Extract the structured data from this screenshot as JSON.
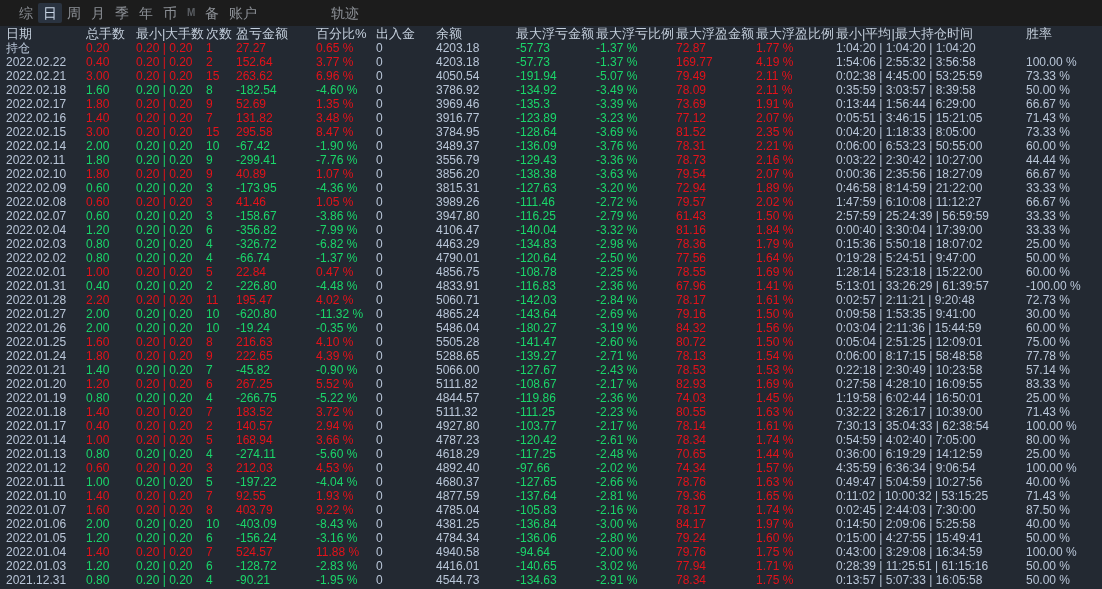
{
  "tabs": [
    {
      "label": "综",
      "selected": false,
      "disabled": false
    },
    {
      "label": "日",
      "selected": true,
      "disabled": false
    },
    {
      "label": "周",
      "selected": false,
      "disabled": false
    },
    {
      "label": "月",
      "selected": false,
      "disabled": false
    },
    {
      "label": "季",
      "selected": false,
      "disabled": false
    },
    {
      "label": "年",
      "selected": false,
      "disabled": false
    },
    {
      "label": "币",
      "selected": false,
      "disabled": false
    },
    {
      "label": "M",
      "selected": false,
      "disabled": true
    },
    {
      "label": "备",
      "selected": false,
      "disabled": false
    },
    {
      "label": "账户",
      "selected": false,
      "disabled": false
    },
    {
      "label": "轨迹",
      "selected": false,
      "disabled": false
    }
  ],
  "table": {
    "columns": [
      "日期",
      "总手数",
      "最小|大手数",
      "次数",
      "盈亏金额",
      "百分比%",
      "出入金",
      "余额",
      "最大浮亏金额",
      "最大浮亏比例",
      "最大浮盈金额",
      "最大浮盈比例",
      "最小|平均|最大持仓时间",
      "胜率"
    ],
    "rows": [
      {
        "kind": "profit",
        "cells": [
          "持仓",
          "0.20",
          "0.20 | 0.20",
          "1",
          "27.27",
          "0.65 %",
          "0",
          "4203.18",
          "-57.73",
          "-1.37 %",
          "72.87",
          "1.77 %",
          "1:04:20 | 1:04:20 | 1:04:20"
        ]
      },
      {
        "kind": "profit",
        "cells": [
          "2022.02.22",
          "0.40",
          "0.20 | 0.20",
          "2",
          "152.64",
          "3.77 %",
          "0",
          "4203.18",
          "-57.73",
          "-1.37 %",
          "169.77",
          "4.19 %",
          "1:54:06 | 2:55:32 | 3:56:58",
          "100.00 %"
        ]
      },
      {
        "kind": "profit",
        "cells": [
          "2022.02.21",
          "3.00",
          "0.20 | 0.20",
          "15",
          "263.62",
          "6.96 %",
          "0",
          "4050.54",
          "-191.94",
          "-5.07 %",
          "79.49",
          "2.11 %",
          "0:02:38 | 4:45:00 | 53:25:59",
          "73.33 %"
        ]
      },
      {
        "kind": "loss",
        "cells": [
          "2022.02.18",
          "1.60",
          "0.20 | 0.20",
          "8",
          "-182.54",
          "-4.60 %",
          "0",
          "3786.92",
          "-134.92",
          "-3.49 %",
          "78.09",
          "2.11 %",
          "0:35:59 | 3:03:57 | 8:39:58",
          "50.00 %"
        ]
      },
      {
        "kind": "profit",
        "cells": [
          "2022.02.17",
          "1.80",
          "0.20 | 0.20",
          "9",
          "52.69",
          "1.35 %",
          "0",
          "3969.46",
          "-135.3",
          "-3.39 %",
          "73.69",
          "1.91 %",
          "0:13:44 | 1:56:44 | 6:29:00",
          "66.67 %"
        ]
      },
      {
        "kind": "profit",
        "cells": [
          "2022.02.16",
          "1.40",
          "0.20 | 0.20",
          "7",
          "131.82",
          "3.48 %",
          "0",
          "3916.77",
          "-123.89",
          "-3.23 %",
          "77.12",
          "2.07 %",
          "0:05:51 | 3:46:15 | 15:21:05",
          "71.43 %"
        ]
      },
      {
        "kind": "profit",
        "cells": [
          "2022.02.15",
          "3.00",
          "0.20 | 0.20",
          "15",
          "295.58",
          "8.47 %",
          "0",
          "3784.95",
          "-128.64",
          "-3.69 %",
          "81.52",
          "2.35 %",
          "0:04:20 | 1:18:33 | 8:05:00",
          "73.33 %"
        ]
      },
      {
        "kind": "loss",
        "cells": [
          "2022.02.14",
          "2.00",
          "0.20 | 0.20",
          "10",
          "-67.42",
          "-1.90 %",
          "0",
          "3489.37",
          "-136.09",
          "-3.76 %",
          "78.31",
          "2.21 %",
          "0:06:00 | 6:53:23 | 50:55:00",
          "60.00 %"
        ]
      },
      {
        "kind": "loss",
        "cells": [
          "2022.02.11",
          "1.80",
          "0.20 | 0.20",
          "9",
          "-299.41",
          "-7.76 %",
          "0",
          "3556.79",
          "-129.43",
          "-3.36 %",
          "78.73",
          "2.16 %",
          "0:03:22 | 2:30:42 | 10:27:00",
          "44.44 %"
        ]
      },
      {
        "kind": "profit",
        "cells": [
          "2022.02.10",
          "1.80",
          "0.20 | 0.20",
          "9",
          "40.89",
          "1.07 %",
          "0",
          "3856.20",
          "-138.38",
          "-3.63 %",
          "79.54",
          "2.07 %",
          "0:00:36 | 2:35:56 | 18:27:09",
          "66.67 %"
        ]
      },
      {
        "kind": "loss",
        "cells": [
          "2022.02.09",
          "0.60",
          "0.20 | 0.20",
          "3",
          "-173.95",
          "-4.36 %",
          "0",
          "3815.31",
          "-127.63",
          "-3.20 %",
          "72.94",
          "1.89 %",
          "0:46:58 | 8:14:59 | 21:22:00",
          "33.33 %"
        ]
      },
      {
        "kind": "profit",
        "cells": [
          "2022.02.08",
          "0.60",
          "0.20 | 0.20",
          "3",
          "41.46",
          "1.05 %",
          "0",
          "3989.26",
          "-111.46",
          "-2.72 %",
          "79.57",
          "2.02 %",
          "1:47:59 | 6:10:08 | 11:12:27",
          "66.67 %"
        ]
      },
      {
        "kind": "loss",
        "cells": [
          "2022.02.07",
          "0.60",
          "0.20 | 0.20",
          "3",
          "-158.67",
          "-3.86 %",
          "0",
          "3947.80",
          "-116.25",
          "-2.79 %",
          "61.43",
          "1.50 %",
          "2:57:59 | 25:24:39 | 56:59:59",
          "33.33 %"
        ]
      },
      {
        "kind": "loss",
        "cells": [
          "2022.02.04",
          "1.20",
          "0.20 | 0.20",
          "6",
          "-356.82",
          "-7.99 %",
          "0",
          "4106.47",
          "-140.04",
          "-3.32 %",
          "81.16",
          "1.84 %",
          "0:00:40 | 3:30:04 | 17:39:00",
          "33.33 %"
        ]
      },
      {
        "kind": "loss",
        "cells": [
          "2022.02.03",
          "0.80",
          "0.20 | 0.20",
          "4",
          "-326.72",
          "-6.82 %",
          "0",
          "4463.29",
          "-134.83",
          "-2.98 %",
          "78.36",
          "1.79 %",
          "0:15:36 | 5:50:18 | 18:07:02",
          "25.00 %"
        ]
      },
      {
        "kind": "loss",
        "cells": [
          "2022.02.02",
          "0.80",
          "0.20 | 0.20",
          "4",
          "-66.74",
          "-1.37 %",
          "0",
          "4790.01",
          "-120.64",
          "-2.50 %",
          "77.56",
          "1.64 %",
          "0:19:28 | 5:24:51 | 9:47:00",
          "50.00 %"
        ]
      },
      {
        "kind": "profit",
        "cells": [
          "2022.02.01",
          "1.00",
          "0.20 | 0.20",
          "5",
          "22.84",
          "0.47 %",
          "0",
          "4856.75",
          "-108.78",
          "-2.25 %",
          "78.55",
          "1.69 %",
          "1:28:14 | 5:23:18 | 15:22:00",
          "60.00 %"
        ]
      },
      {
        "kind": "loss",
        "cells": [
          "2022.01.31",
          "0.40",
          "0.20 | 0.20",
          "2",
          "-226.80",
          "-4.48 %",
          "0",
          "4833.91",
          "-116.83",
          "-2.36 %",
          "67.96",
          "1.41 %",
          "5:13:01 | 33:26:29 | 61:39:57",
          "-100.00 %"
        ]
      },
      {
        "kind": "profit",
        "cells": [
          "2022.01.28",
          "2.20",
          "0.20 | 0.20",
          "11",
          "195.47",
          "4.02 %",
          "0",
          "5060.71",
          "-142.03",
          "-2.84 %",
          "78.17",
          "1.61 %",
          "0:02:57 | 2:11:21 | 9:20:48",
          "72.73 %"
        ]
      },
      {
        "kind": "loss",
        "cells": [
          "2022.01.27",
          "2.00",
          "0.20 | 0.20",
          "10",
          "-620.80",
          "-11.32 %",
          "0",
          "4865.24",
          "-143.64",
          "-2.69 %",
          "79.16",
          "1.50 %",
          "0:09:58 | 1:53:35 | 9:41:00",
          "30.00 %"
        ]
      },
      {
        "kind": "loss",
        "cells": [
          "2022.01.26",
          "2.00",
          "0.20 | 0.20",
          "10",
          "-19.24",
          "-0.35 %",
          "0",
          "5486.04",
          "-180.27",
          "-3.19 %",
          "84.32",
          "1.56 %",
          "0:03:04 | 2:11:36 | 15:44:59",
          "60.00 %"
        ]
      },
      {
        "kind": "profit",
        "cells": [
          "2022.01.25",
          "1.60",
          "0.20 | 0.20",
          "8",
          "216.63",
          "4.10 %",
          "0",
          "5505.28",
          "-141.47",
          "-2.60 %",
          "80.72",
          "1.50 %",
          "0:05:04 | 2:51:25 | 12:09:01",
          "75.00 %"
        ]
      },
      {
        "kind": "profit",
        "cells": [
          "2022.01.24",
          "1.80",
          "0.20 | 0.20",
          "9",
          "222.65",
          "4.39 %",
          "0",
          "5288.65",
          "-139.27",
          "-2.71 %",
          "78.13",
          "1.54 %",
          "0:06:00 | 8:17:15 | 58:48:58",
          "77.78 %"
        ]
      },
      {
        "kind": "loss",
        "cells": [
          "2022.01.21",
          "1.40",
          "0.20 | 0.20",
          "7",
          "-45.82",
          "-0.90 %",
          "0",
          "5066.00",
          "-127.67",
          "-2.43 %",
          "78.53",
          "1.53 %",
          "0:22:18 | 2:30:49 | 10:23:58",
          "57.14 %"
        ]
      },
      {
        "kind": "profit",
        "cells": [
          "2022.01.20",
          "1.20",
          "0.20 | 0.20",
          "6",
          "267.25",
          "5.52 %",
          "0",
          "5111.82",
          "-108.67",
          "-2.17 %",
          "82.93",
          "1.69 %",
          "0:27:58 | 4:28:10 | 16:09:55",
          "83.33 %"
        ]
      },
      {
        "kind": "loss",
        "cells": [
          "2022.01.19",
          "0.80",
          "0.20 | 0.20",
          "4",
          "-266.75",
          "-5.22 %",
          "0",
          "4844.57",
          "-119.86",
          "-2.36 %",
          "74.03",
          "1.45 %",
          "1:19:58 | 6:02:44 | 16:50:01",
          "25.00 %"
        ]
      },
      {
        "kind": "profit",
        "cells": [
          "2022.01.18",
          "1.40",
          "0.20 | 0.20",
          "7",
          "183.52",
          "3.72 %",
          "0",
          "5111.32",
          "-111.25",
          "-2.23 %",
          "80.55",
          "1.63 %",
          "0:32:22 | 3:26:17 | 10:39:00",
          "71.43 %"
        ]
      },
      {
        "kind": "profit",
        "cells": [
          "2022.01.17",
          "0.40",
          "0.20 | 0.20",
          "2",
          "140.57",
          "2.94 %",
          "0",
          "4927.80",
          "-103.77",
          "-2.17 %",
          "78.14",
          "1.61 %",
          "7:30:13 | 35:04:33 | 62:38:54",
          "100.00 %"
        ]
      },
      {
        "kind": "profit",
        "cells": [
          "2022.01.14",
          "1.00",
          "0.20 | 0.20",
          "5",
          "168.94",
          "3.66 %",
          "0",
          "4787.23",
          "-120.42",
          "-2.61 %",
          "78.34",
          "1.74 %",
          "0:54:59 | 4:02:40 | 7:05:00",
          "80.00 %"
        ]
      },
      {
        "kind": "loss",
        "cells": [
          "2022.01.13",
          "0.80",
          "0.20 | 0.20",
          "4",
          "-274.11",
          "-5.60 %",
          "0",
          "4618.29",
          "-117.25",
          "-2.48 %",
          "70.65",
          "1.44 %",
          "0:36:00 | 6:19:29 | 14:12:59",
          "25.00 %"
        ]
      },
      {
        "kind": "profit",
        "cells": [
          "2022.01.12",
          "0.60",
          "0.20 | 0.20",
          "3",
          "212.03",
          "4.53 %",
          "0",
          "4892.40",
          "-97.66",
          "-2.02 %",
          "74.34",
          "1.57 %",
          "4:35:59 | 6:36:34 | 9:06:54",
          "100.00 %"
        ]
      },
      {
        "kind": "loss",
        "cells": [
          "2022.01.11",
          "1.00",
          "0.20 | 0.20",
          "5",
          "-197.22",
          "-4.04 %",
          "0",
          "4680.37",
          "-127.65",
          "-2.66 %",
          "78.76",
          "1.63 %",
          "0:49:47 | 5:04:59 | 10:27:56",
          "40.00 %"
        ]
      },
      {
        "kind": "profit",
        "cells": [
          "2022.01.10",
          "1.40",
          "0.20 | 0.20",
          "7",
          "92.55",
          "1.93 %",
          "0",
          "4877.59",
          "-137.64",
          "-2.81 %",
          "79.36",
          "1.65 %",
          "0:11:02 | 10:00:32 | 53:15:25",
          "71.43 %"
        ]
      },
      {
        "kind": "profit",
        "cells": [
          "2022.01.07",
          "1.60",
          "0.20 | 0.20",
          "8",
          "403.79",
          "9.22 %",
          "0",
          "4785.04",
          "-105.83",
          "-2.16 %",
          "78.17",
          "1.74 %",
          "0:02:45 | 2:44:03 | 7:30:00",
          "87.50 %"
        ]
      },
      {
        "kind": "loss",
        "cells": [
          "2022.01.06",
          "2.00",
          "0.20 | 0.20",
          "10",
          "-403.09",
          "-8.43 %",
          "0",
          "4381.25",
          "-136.84",
          "-3.00 %",
          "84.17",
          "1.97 %",
          "0:14:50 | 2:09:06 | 5:25:58",
          "40.00 %"
        ]
      },
      {
        "kind": "loss",
        "cells": [
          "2022.01.05",
          "1.20",
          "0.20 | 0.20",
          "6",
          "-156.24",
          "-3.16 %",
          "0",
          "4784.34",
          "-136.06",
          "-2.80 %",
          "79.24",
          "1.60 %",
          "0:15:00 | 4:27:55 | 15:49:41",
          "50.00 %"
        ]
      },
      {
        "kind": "profit",
        "cells": [
          "2022.01.04",
          "1.40",
          "0.20 | 0.20",
          "7",
          "524.57",
          "11.88 %",
          "0",
          "4940.58",
          "-94.64",
          "-2.00 %",
          "79.76",
          "1.75 %",
          "0:43:00 | 3:29:08 | 16:34:59",
          "100.00 %"
        ]
      },
      {
        "kind": "loss",
        "cells": [
          "2022.01.03",
          "1.20",
          "0.20 | 0.20",
          "6",
          "-128.72",
          "-2.83 %",
          "0",
          "4416.01",
          "-140.65",
          "-3.02 %",
          "77.94",
          "1.71 %",
          "0:28:39 | 11:25:51 | 61:15:16",
          "50.00 %"
        ]
      },
      {
        "kind": "loss",
        "cells": [
          "2021.12.31",
          "0.80",
          "0.20 | 0.20",
          "4",
          "-90.21",
          "-1.95 %",
          "0",
          "4544.73",
          "-134.63",
          "-2.91 %",
          "78.34",
          "1.75 %",
          "0:13:57 | 5:07:33 | 16:05:58",
          "50.00 %"
        ]
      }
    ]
  }
}
